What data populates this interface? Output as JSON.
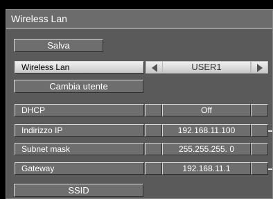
{
  "window": {
    "title": "Wireless Lan"
  },
  "buttons": {
    "save": "Salva",
    "change_user": "Cambia utente",
    "ssid": "SSID"
  },
  "wireless": {
    "label": "Wireless Lan",
    "value": "USER1"
  },
  "network": {
    "rows": [
      {
        "label": "DHCP",
        "value": "Off"
      },
      {
        "label": "Indirizzo IP",
        "value": "192.168.11.100"
      },
      {
        "label": "Subnet mask",
        "value": "255.255.255. 0"
      },
      {
        "label": "Gateway",
        "value": "192.168.11.1"
      }
    ]
  },
  "icons": {
    "prev": "left-arrow-icon",
    "next": "right-arrow-icon"
  }
}
